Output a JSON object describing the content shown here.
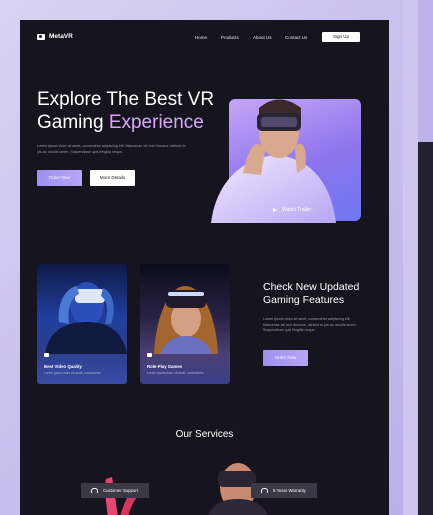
{
  "nav": {
    "logo": "MetaVR",
    "links": [
      "Home",
      "Products",
      "About Us",
      "Contact Us"
    ],
    "signup": "Sign Up"
  },
  "hero": {
    "title_line1": "Explore The Best VR",
    "title_line2_plain": "Gaming ",
    "title_line2_accent": "Experience",
    "description": "Lorem ipsum dolor sit amet, consectetur adipiscing elit. Maecenas vel orci rhoncus, ultrices to pis ac, iaculis lorem. Suspendisse quis fringilla neque.",
    "order_button": "Order Now",
    "more_button": "More Details",
    "trailer_label": "Watch Trailer"
  },
  "cards": [
    {
      "title": "Best Video Quality",
      "subtitle": "Lorem ipsum dolor sit amet, consectetur"
    },
    {
      "title": "Role-Play Games",
      "subtitle": "Lorem ipsum dolor sit amet, consectetur"
    }
  ],
  "features": {
    "title": "Check New Updated Gaming Features",
    "text": "Lorem ipsum dolor sit amet, consectetur adipiscing elit. Maecenas vel orci rhoncus, ultrices to pis ac, iaculis lorem. Suspendisse quis fringilla neque.",
    "order_button": "Order Now"
  },
  "services": {
    "title": "Our Services",
    "items": [
      "Customer Support",
      "5 Years Warranty"
    ]
  },
  "colors": {
    "background": "#16151f",
    "accent": "#a798f3",
    "accent_text": "#d9a6f7"
  }
}
